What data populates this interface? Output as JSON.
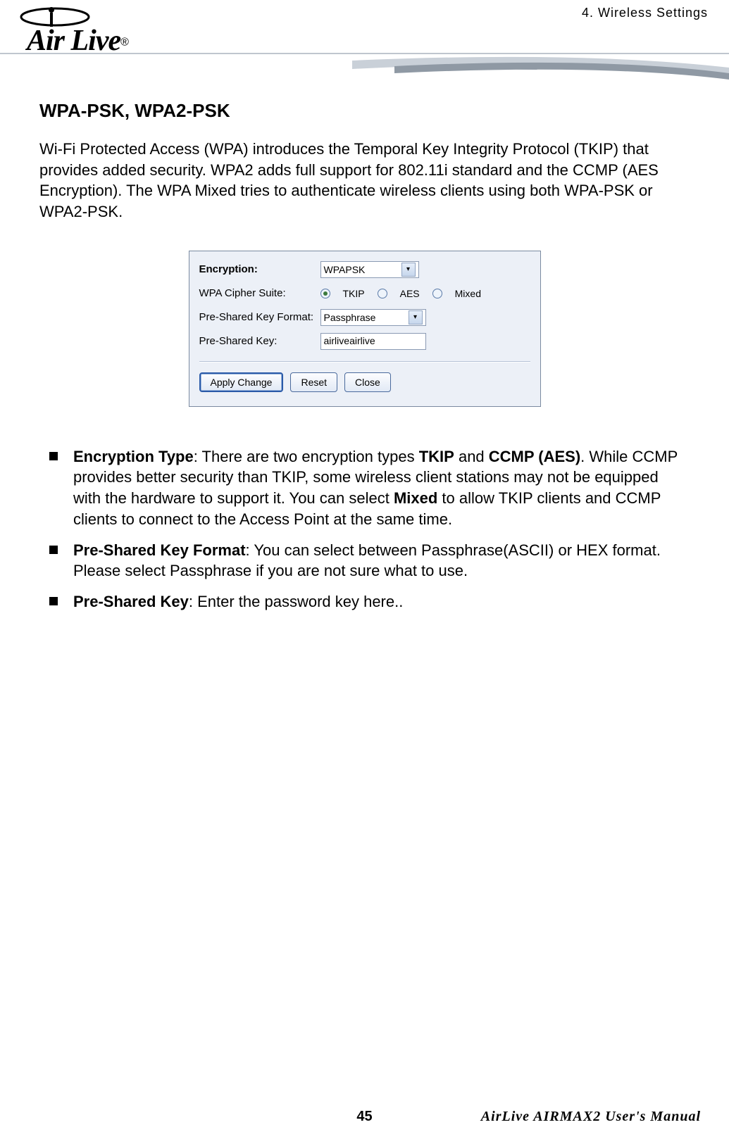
{
  "header": {
    "chapter": "4. Wireless Settings",
    "logo_text": "Air Live",
    "registered": "®"
  },
  "section": {
    "title": "WPA-PSK, WPA2-PSK",
    "intro": "Wi-Fi Protected Access (WPA) introduces the Temporal Key Integrity Protocol (TKIP) that provides added security.    WPA2 adds full support for 802.11i standard and the CCMP (AES Encryption).    The WPA Mixed tries to authenticate wireless clients using both WPA-PSK or WPA2-PSK."
  },
  "dialog": {
    "encryption_label": "Encryption:",
    "encryption_value": "WPAPSK",
    "cipher_label": "WPA Cipher Suite:",
    "radio_tkip": "TKIP",
    "radio_aes": "AES",
    "radio_mixed": "Mixed",
    "psk_format_label": "Pre-Shared Key Format:",
    "psk_format_value": "Passphrase",
    "psk_label": "Pre-Shared Key:",
    "psk_value": "airliveairlive",
    "btn_apply": "Apply Change",
    "btn_reset": "Reset",
    "btn_close": "Close"
  },
  "bullets": {
    "b1_term": "Encryption Type",
    "b1_mid1": ":    There are two encryption types ",
    "b1_tkip": "TKIP",
    "b1_and": " and ",
    "b1_ccmp": "CCMP (AES)",
    "b1_mid2": ". While CCMP provides better security than TKIP, some wireless client stations may not be equipped with the hardware to support it. You can select ",
    "b1_mixed": "Mixed",
    "b1_end": " to allow TKIP clients and CCMP clients to connect to the Access Point at the same time.",
    "b2_term": "Pre-Shared Key Format",
    "b2_body": ":    You can select between Passphrase(ASCII) or HEX format.    Please select Passphrase if you are not sure what to use.",
    "b3_term": "Pre-Shared Key",
    "b3_body": ":    Enter the password key here.."
  },
  "footer": {
    "page": "45",
    "manual": "AirLive AIRMAX2 User's Manual"
  }
}
